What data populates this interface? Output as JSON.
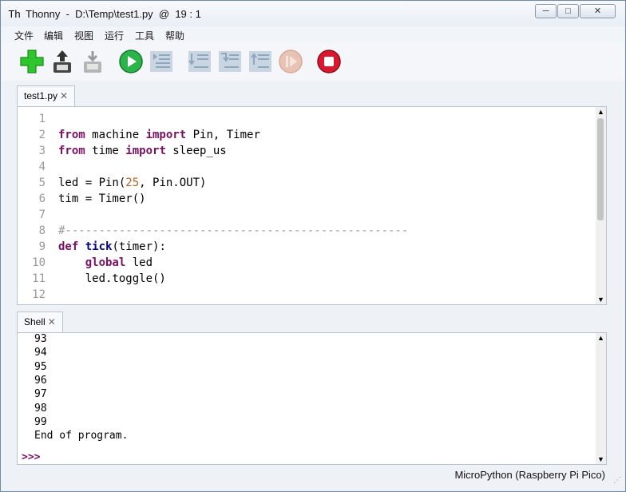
{
  "window": {
    "title": "Thonny  -  D:\\Temp\\test1.py  @  19 : 1",
    "controls": {
      "minimize": "─",
      "maximize": "□",
      "close": "✕"
    }
  },
  "menu": [
    "文件",
    "编辑",
    "视图",
    "运行",
    "工具",
    "帮助"
  ],
  "toolbar": [
    {
      "name": "new-file",
      "icon": "green-plus",
      "color": "#2ec52e",
      "enabled": true
    },
    {
      "name": "open-file",
      "icon": "folder-up-arrow",
      "color": "#333333",
      "enabled": true
    },
    {
      "name": "save-file",
      "icon": "floppy-disk",
      "color": "#9a9a9a",
      "enabled": false
    },
    {
      "name": "run",
      "icon": "play",
      "color": "#2cb34a",
      "enabled": true
    },
    {
      "name": "debug",
      "icon": "debug-list",
      "color": "#8fa7bf",
      "enabled": false
    },
    {
      "name": "step-over",
      "icon": "step-over-list",
      "color": "#8fa7bf",
      "enabled": false
    },
    {
      "name": "step-into",
      "icon": "step-into-list",
      "color": "#8fa7bf",
      "enabled": false
    },
    {
      "name": "step-out",
      "icon": "step-out-list",
      "color": "#8fa7bf",
      "enabled": false
    },
    {
      "name": "resume",
      "icon": "resume",
      "color": "#e0b6a6",
      "enabled": false
    },
    {
      "name": "stop",
      "icon": "stop",
      "color": "#d9192f",
      "enabled": true
    }
  ],
  "editor": {
    "tab_label": "test1.py",
    "tab_close": "✕",
    "line_numbers": [
      "1",
      "2",
      "3",
      "4",
      "5",
      "6",
      "7",
      "8",
      "9",
      "10",
      "11",
      "12"
    ],
    "code_lines": [
      [],
      [
        {
          "t": "from",
          "k": "kw"
        },
        {
          "t": " machine "
        },
        {
          "t": "import",
          "k": "kw"
        },
        {
          "t": " Pin, Timer"
        }
      ],
      [
        {
          "t": "from",
          "k": "kw"
        },
        {
          "t": " time "
        },
        {
          "t": "import",
          "k": "kw"
        },
        {
          "t": " sleep_us"
        }
      ],
      [],
      [
        {
          "t": "led = Pin("
        },
        {
          "t": "25",
          "k": "num"
        },
        {
          "t": ", Pin.OUT)"
        }
      ],
      [
        {
          "t": "tim = Timer()"
        }
      ],
      [],
      [
        {
          "t": "#---------------------------------------------------",
          "k": "cm"
        }
      ],
      [
        {
          "t": "def",
          "k": "kw"
        },
        {
          "t": " "
        },
        {
          "t": "tick",
          "k": "fn"
        },
        {
          "t": "(timer):"
        }
      ],
      [
        {
          "t": "    "
        },
        {
          "t": "global",
          "k": "kw"
        },
        {
          "t": " led"
        }
      ],
      [
        {
          "t": "    led.toggle()"
        }
      ],
      []
    ]
  },
  "shell": {
    "tab_label": "Shell",
    "tab_close": "✕",
    "lines": [
      "93",
      "94",
      "95",
      "96",
      "97",
      "98",
      "99",
      "End of program."
    ],
    "prompt": ">>>"
  },
  "status": {
    "interpreter": "MicroPython (Raspberry Pi Pico)"
  },
  "colors": {
    "keyword": "#7a0f63",
    "function": "#00008b",
    "number": "#b5651d",
    "comment": "#9a9a9a"
  }
}
